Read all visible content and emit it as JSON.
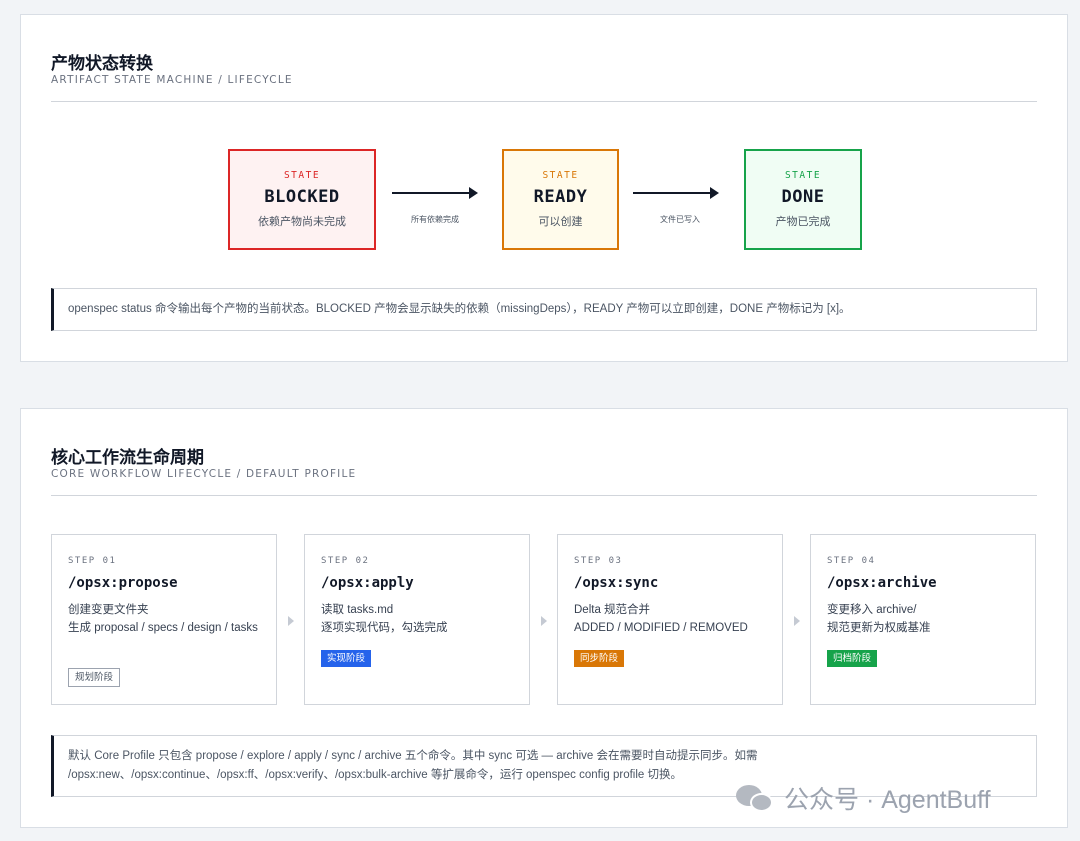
{
  "section1": {
    "title": "产物状态转换",
    "subtitle": "ARTIFACT STATE MACHINE / LIFECYCLE",
    "states": [
      {
        "label": "STATE",
        "name": "BLOCKED",
        "desc": "依赖产物尚未完成",
        "color": "#dc2626",
        "bg": "#fef2f2"
      },
      {
        "label": "STATE",
        "name": "READY",
        "desc": "可以创建",
        "color": "#d97706",
        "bg": "#fffbeb"
      },
      {
        "label": "STATE",
        "name": "DONE",
        "desc": "产物已完成",
        "color": "#16a34a",
        "bg": "#f0fdf4"
      }
    ],
    "transitions": [
      "所有依赖完成",
      "文件已写入"
    ],
    "note": "openspec status 命令输出每个产物的当前状态。BLOCKED 产物会显示缺失的依赖（missingDeps），READY 产物可以立即创建，DONE 产物标记为 [x]。"
  },
  "section2": {
    "title": "核心工作流生命周期",
    "subtitle": "CORE WORKFLOW LIFECYCLE / DEFAULT PROFILE",
    "steps": [
      {
        "label": "STEP 01",
        "cmd": "/opsx:propose",
        "desc": "创建变更文件夹\n生成 proposal / specs / design / tasks",
        "tag": "规划阶段"
      },
      {
        "label": "STEP 02",
        "cmd": "/opsx:apply",
        "desc": "读取 tasks.md\n逐项实现代码，勾选完成",
        "tag": "实现阶段"
      },
      {
        "label": "STEP 03",
        "cmd": "/opsx:sync",
        "desc": "Delta 规范合并\nADDED / MODIFIED / REMOVED",
        "tag": "同步阶段"
      },
      {
        "label": "STEP 04",
        "cmd": "/opsx:archive",
        "desc": "变更移入 archive/\n规范更新为权威基准",
        "tag": "归档阶段"
      }
    ],
    "note": "默认 Core Profile 只包含 propose / explore / apply / sync / archive 五个命令。其中 sync 可选 — archive 会在需要时自动提示同步。如需 /opsx:new、/opsx:continue、/opsx:ff、/opsx:verify、/opsx:bulk-archive 等扩展命令，运行 openspec config profile 切换。"
  },
  "watermark": {
    "text": "公众号 · AgentBuff",
    "icon": "wechat-icon"
  }
}
